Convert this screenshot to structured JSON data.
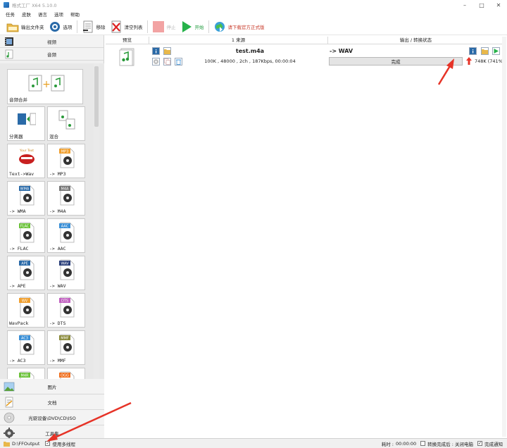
{
  "window": {
    "title": "格式工厂 X64 5.10.0"
  },
  "menu": [
    "任务",
    "皮肤",
    "语言",
    "选项",
    "帮助"
  ],
  "toolbar": {
    "output_folder": "输出文件夹",
    "options": "选项",
    "remove": "移除",
    "clear_list": "清空列表",
    "stop": "停止",
    "start": "开始",
    "download": "请下载官方正式版"
  },
  "sidebar": {
    "video": "视频",
    "audio": "音频",
    "tiles": [
      {
        "label": "音频合并",
        "kind": "merge"
      },
      {
        "label": "分离器",
        "kind": "splitter"
      },
      {
        "label": "混合",
        "kind": "mix"
      },
      {
        "label": "Text->Wav",
        "kind": "text"
      },
      {
        "label": "-> MP3",
        "badge": "MP3",
        "color": "#f0a030"
      },
      {
        "label": "-> WMA",
        "badge": "WMA",
        "color": "#2a6aa8"
      },
      {
        "label": "-> M4A",
        "badge": "M4A",
        "color": "#777777"
      },
      {
        "label": "-> FLAC",
        "badge": "FLAC",
        "color": "#6bc23a"
      },
      {
        "label": "-> AAC",
        "badge": "AAC",
        "color": "#3a8fd6"
      },
      {
        "label": "-> APE",
        "badge": "APE",
        "color": "#2a6aa8"
      },
      {
        "label": "-> WAV",
        "badge": "WAV",
        "color": "#2a3f7a"
      },
      {
        "label": "WavPack",
        "badge": "WV",
        "color": "#f0a030"
      },
      {
        "label": "-> DTS",
        "badge": "DTS",
        "color": "#c060c0"
      },
      {
        "label": "-> AC3",
        "badge": "AC3",
        "color": "#3a8fd6"
      },
      {
        "label": "-> MMF",
        "badge": "MMF",
        "color": "#8a8a3a"
      },
      {
        "label": "",
        "badge": "M4R",
        "color": "#6bc23a"
      },
      {
        "label": "",
        "badge": "OGG",
        "color": "#f07020"
      }
    ],
    "picture": "图片",
    "document": "文档",
    "optical": "光驱设备\\DVD\\CD\\ISO",
    "toolbox": "工具集"
  },
  "table": {
    "headers": {
      "preview": "预览",
      "source": "1 来源",
      "output": "输出 / 转换状态"
    },
    "rows": [
      {
        "name": "test.m4a",
        "info": "100K , 48000 , 2ch , 187Kbps, 00:00:04",
        "target": "-> WAV",
        "status": "完成",
        "progress": 1.0,
        "out_size": "748K",
        "ratio": "(741%)"
      }
    ]
  },
  "status": {
    "path": "D:\\FFOutput",
    "multithread": "使用多线程",
    "elapsed_label": "耗时 :",
    "elapsed": "00:00:00",
    "after_convert": "转换完成后 : 关闭电脑",
    "notify": "完成通知"
  },
  "colors": {
    "annotation_arrow": "#e63327",
    "accent": "#2a6aa8"
  }
}
